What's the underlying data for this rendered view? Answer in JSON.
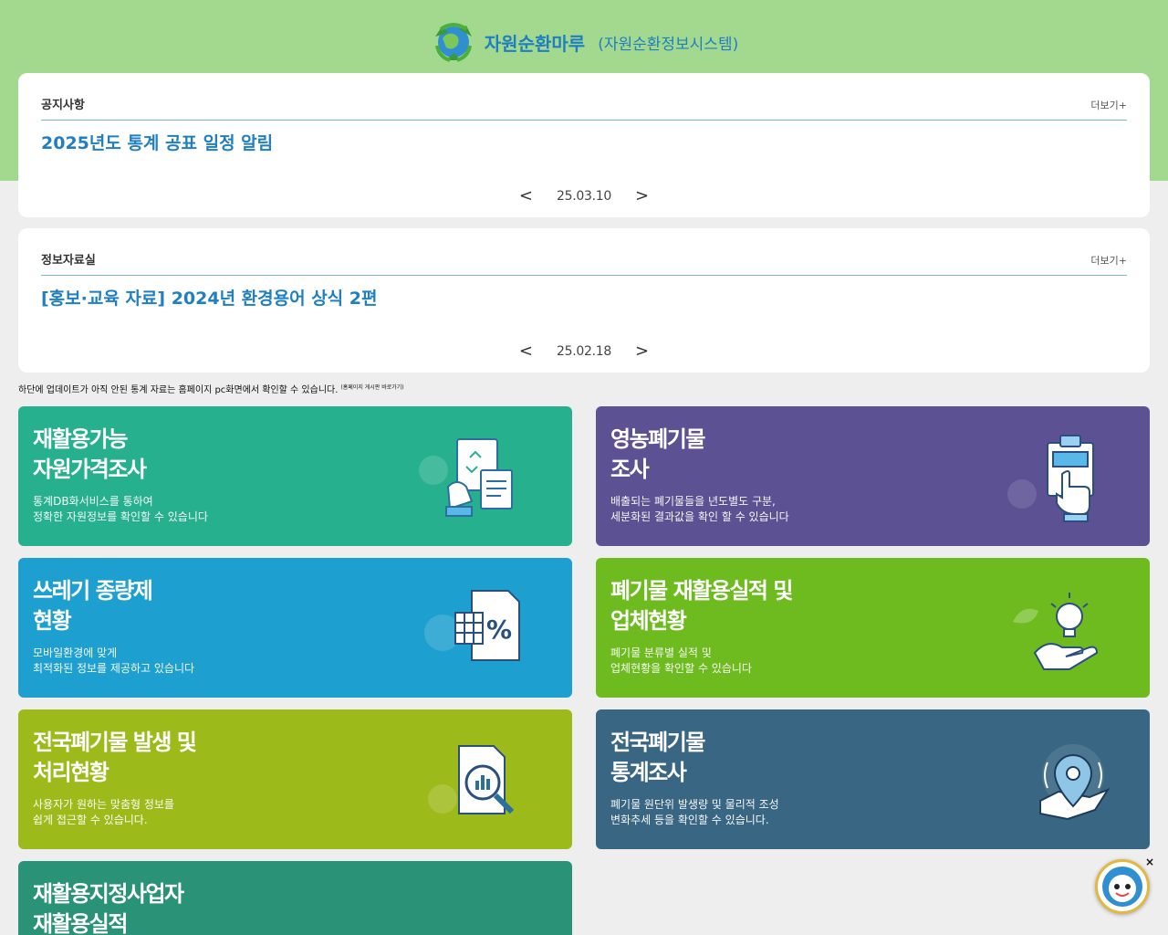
{
  "header": {
    "title": "자원순환마루",
    "subtitle": "(자원순환정보시스템)",
    "logo_icon": "recycle-globe-icon"
  },
  "notice": {
    "label": "공지사항",
    "more": "더보기+",
    "headline": "2025년도 통계 공표 일정 알림",
    "date": "25.03.10",
    "prev": "<",
    "next": ">"
  },
  "archive": {
    "label": "정보자료실",
    "more": "더보기+",
    "headline": "[홍보·교육 자료] 2024년 환경용어 상식 2편",
    "date": "25.02.18",
    "prev": "<",
    "next": ">"
  },
  "disclaimer": {
    "text": "하단에 업데이트가 아직 안된 통계 자료는 홈페이지 pc화면에서 확인할 수 있습니다.",
    "note": "(홈페이지 게시판 바로가기)"
  },
  "cards": [
    {
      "title1": "재활용가능",
      "title2": "자원가격조사",
      "desc1": "통계DB화서비스를 통하여",
      "desc2": "정확한 자원정보를 확인할 수 있습니다",
      "icon": "document-hand-icon",
      "color": "#26b08e"
    },
    {
      "title1": "영농폐기물",
      "title2": "조사",
      "desc1": "배출되는 폐기물들을 년도별도 구분,",
      "desc2": "세분화된 결과값을 확인 할 수 있습니다",
      "icon": "clipboard-touch-icon",
      "color": "#5c5192"
    },
    {
      "title1": "쓰레기 종량제",
      "title2": "현황",
      "desc1": "모바일환경에 맞게",
      "desc2": "최적화된 정보를 제공하고 있습니다",
      "icon": "spreadsheet-percent-icon",
      "color": "#1d9fcf"
    },
    {
      "title1": "폐기물 재활용실적 및",
      "title2": "업체현황",
      "desc1": "폐기물 분류별 실적 및",
      "desc2": "업체현황을 확인할 수 있습니다",
      "icon": "lightbulb-hand-icon",
      "color": "#6dbb1e"
    },
    {
      "title1": "전국폐기물 발생 및",
      "title2": "처리현황",
      "desc1": "사용자가 원하는 맞춤형 정보를",
      "desc2": "쉽게 접근할 수 있습니다.",
      "icon": "document-magnifier-icon",
      "color": "#9dba1b"
    },
    {
      "title1": "전국폐기물",
      "title2": "통계조사",
      "desc1": "폐기물 원단위 발생량 및 물리적 조성",
      "desc2": "변화추세 등을 확인할 수 있습니다.",
      "icon": "map-pin-icon",
      "color": "#386683"
    },
    {
      "title1": "재활용지정사업자",
      "title2": "재활용실적",
      "icon": "board-icon",
      "color": "#2a9377"
    }
  ],
  "chatbot": {
    "icon": "chatbot-avatar-icon",
    "close": "×"
  }
}
